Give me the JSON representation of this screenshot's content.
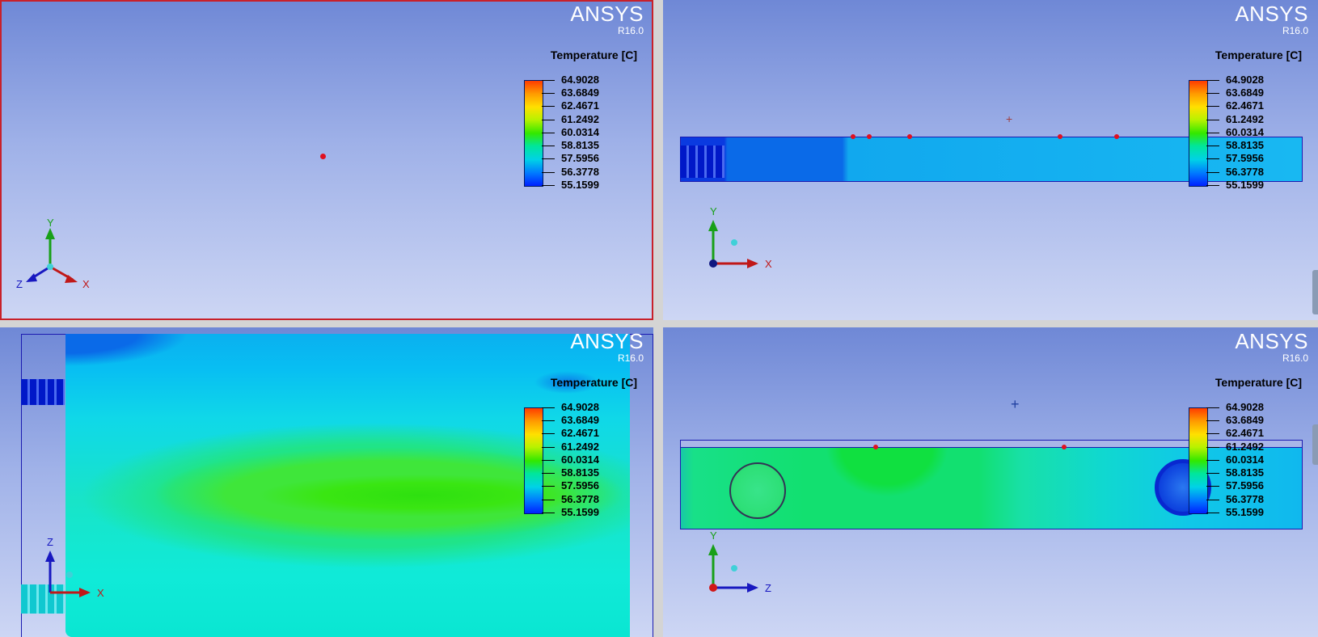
{
  "brand": {
    "name": "ANSYS",
    "version": "R16.0"
  },
  "legend": {
    "title": "Temperature [C]",
    "values": [
      "64.9028",
      "63.6849",
      "62.4671",
      "61.2492",
      "60.0314",
      "58.8135",
      "57.5956",
      "56.3778",
      "55.1599"
    ]
  },
  "viewports": [
    {
      "id": "iso",
      "axes": [
        "Y",
        "Z",
        "X"
      ]
    },
    {
      "id": "front",
      "axes": [
        "Y",
        "X"
      ]
    },
    {
      "id": "top",
      "axes": [
        "Z",
        "X"
      ]
    },
    {
      "id": "side",
      "axes": [
        "Y",
        "Z"
      ]
    }
  ],
  "colors": {
    "background_top": "#6f88d6",
    "background_bottom": "#cdd6f4",
    "active_border": "#c8202a",
    "outline": "#1a1ab0"
  }
}
